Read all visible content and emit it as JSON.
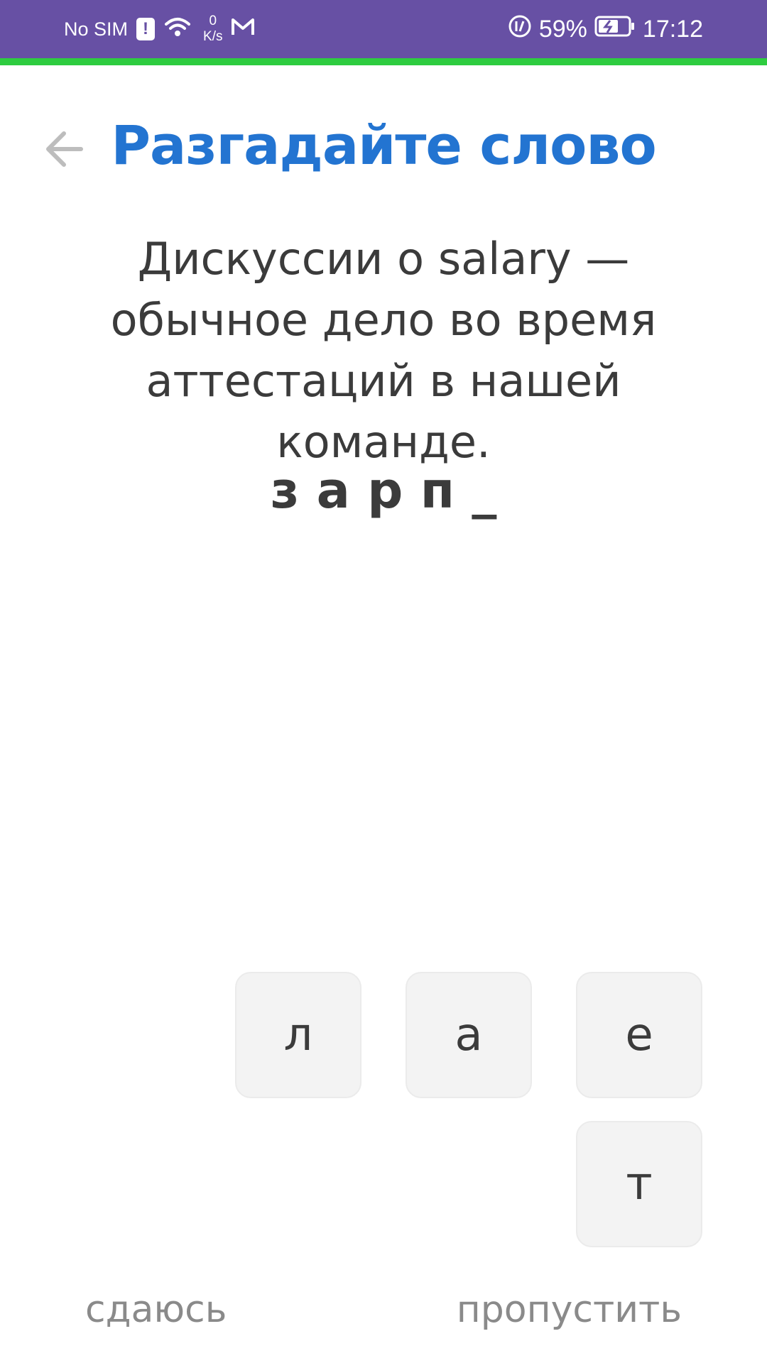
{
  "status_bar": {
    "carrier": "No SIM",
    "speed_value": "0",
    "speed_unit": "K/s",
    "battery_percent": "59%",
    "time": "17:12",
    "icons": [
      "sim-alert-icon",
      "wifi-icon",
      "gmail-icon",
      "data-saver-icon",
      "battery-charging-icon"
    ]
  },
  "header": {
    "title": "Разгадайте слово",
    "back_icon": "back-arrow-icon"
  },
  "quiz": {
    "sentence": "Дискуссии о salary — обычное дело во время аттестаций в нашей команде.",
    "word_progress": "з а р п _"
  },
  "letters": [
    "л",
    "а",
    "е",
    "т"
  ],
  "actions": {
    "give_up": "сдаюсь",
    "skip": "пропустить"
  },
  "colors": {
    "status_bar": "#6750a4",
    "progress": "#2ecc40",
    "title": "#2374d1",
    "tile_bg": "#f3f3f3"
  }
}
